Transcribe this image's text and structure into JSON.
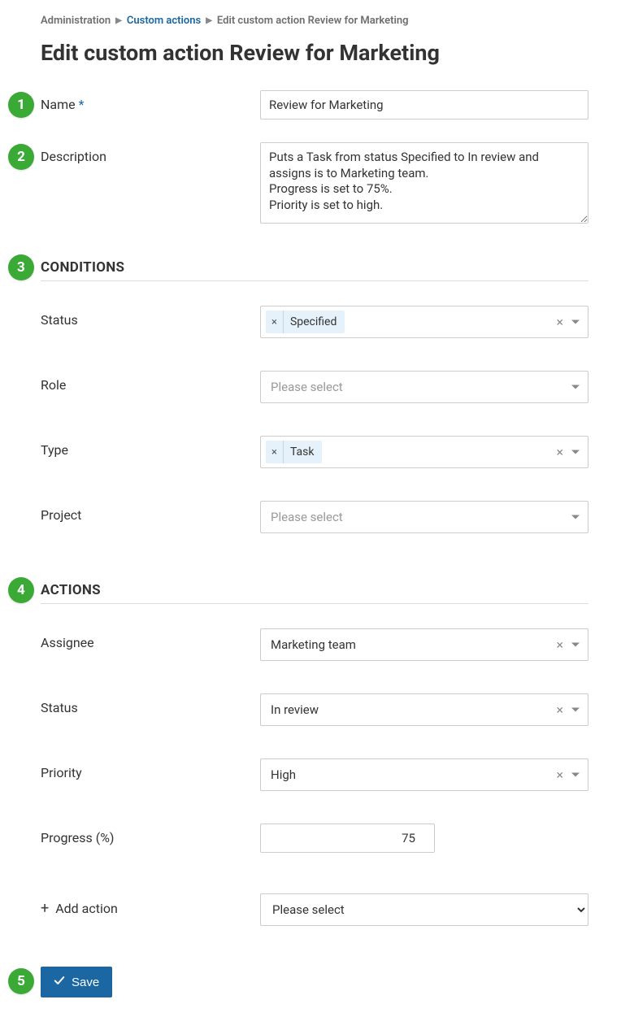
{
  "breadcrumb": {
    "administration": "Administration",
    "custom_actions": "Custom actions",
    "current": "Edit custom action Review for Marketing"
  },
  "page_title": "Edit custom action Review for Marketing",
  "badges": {
    "b1": "1",
    "b2": "2",
    "b3": "3",
    "b4": "4",
    "b5": "5"
  },
  "form": {
    "name_label": "Name",
    "name_value": "Review for Marketing",
    "description_label": "Description",
    "description_value": "Puts a Task from status Specified to In review and assigns is to Marketing team.\nProgress is set to 75%.\nPriority is set to high."
  },
  "conditions": {
    "header": "CONDITIONS",
    "status_label": "Status",
    "status_tag": "Specified",
    "role_label": "Role",
    "role_placeholder": "Please select",
    "type_label": "Type",
    "type_tag": "Task",
    "project_label": "Project",
    "project_placeholder": "Please select"
  },
  "actions": {
    "header": "ACTIONS",
    "assignee_label": "Assignee",
    "assignee_value": "Marketing team",
    "status_label": "Status",
    "status_value": "In review",
    "priority_label": "Priority",
    "priority_value": "High",
    "progress_label": "Progress (%)",
    "progress_value": "75",
    "add_action_label": "Add action",
    "add_action_placeholder": "Please select"
  },
  "buttons": {
    "save": "Save"
  }
}
